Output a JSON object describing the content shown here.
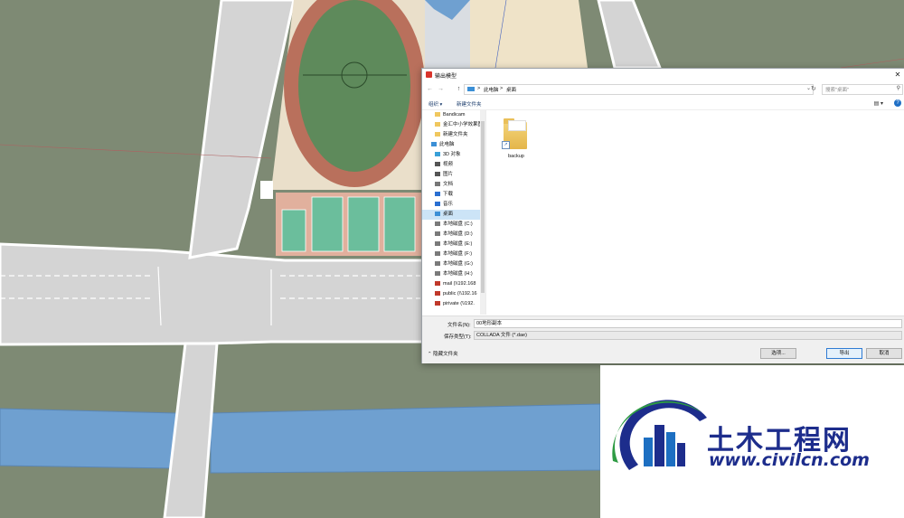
{
  "colors": {
    "field": "#7e8a74",
    "road": "#d4d4d4",
    "river": "#6fa0d0",
    "track": "#b9705c",
    "pitch": "#5e8a5b",
    "court": "#e1b09d",
    "court_green": "#6bbe9c",
    "accent": "#1d2d8c",
    "selection": "#cce4f7",
    "help": "#1f6fc5"
  },
  "dialog": {
    "title": "输出模型",
    "close_icon": "close-icon",
    "nav": {
      "back": "←",
      "forward": "→",
      "up": "↑"
    },
    "address": {
      "crumbs": [
        "此电脑",
        "桌面"
      ],
      "sep": ">"
    },
    "search_placeholder": "搜索\"桌面\"",
    "toolbar": {
      "organize": "组织 ▾",
      "new_folder": "新建文件夹",
      "help": "?"
    },
    "nav_items": [
      {
        "label": "Bandicam",
        "icon": "folder-icon",
        "color": "#f0c75e"
      },
      {
        "label": "金汇中小学效果图",
        "icon": "folder-icon",
        "color": "#f0c75e"
      },
      {
        "label": "新建文件夹",
        "icon": "folder-icon",
        "color": "#f0c75e"
      },
      {
        "label": "此电脑",
        "icon": "pc-icon",
        "color": "#3b8fd6"
      },
      {
        "label": "3D 对象",
        "icon": "cube-icon",
        "color": "#39a0d8"
      },
      {
        "label": "视频",
        "icon": "video-icon",
        "color": "#555555"
      },
      {
        "label": "图片",
        "icon": "picture-icon",
        "color": "#555555"
      },
      {
        "label": "文档",
        "icon": "document-icon",
        "color": "#777777"
      },
      {
        "label": "下载",
        "icon": "download-icon",
        "color": "#2a6fd1"
      },
      {
        "label": "音乐",
        "icon": "music-icon",
        "color": "#2a6fd1"
      },
      {
        "label": "桌面",
        "icon": "desktop-icon",
        "color": "#3b8fd6",
        "selected": true
      },
      {
        "label": "本地磁盘 (C:)",
        "icon": "drive-c-icon",
        "color": "#7a7a7a"
      },
      {
        "label": "本地磁盘 (D:)",
        "icon": "drive-icon",
        "color": "#7a7a7a"
      },
      {
        "label": "本地磁盘 (E:)",
        "icon": "drive-icon",
        "color": "#7a7a7a"
      },
      {
        "label": "本地磁盘 (F:)",
        "icon": "drive-icon",
        "color": "#7a7a7a"
      },
      {
        "label": "本地磁盘 (G:)",
        "icon": "drive-icon",
        "color": "#7a7a7a"
      },
      {
        "label": "本地磁盘 (H:)",
        "icon": "drive-icon",
        "color": "#7a7a7a"
      },
      {
        "label": "mail (\\\\192.168",
        "icon": "network-drive-icon",
        "color": "#c0392b"
      },
      {
        "label": "public (\\\\192.16",
        "icon": "network-drive-icon",
        "color": "#c0392b"
      },
      {
        "label": "pirivate (\\\\192.",
        "icon": "network-drive-icon",
        "color": "#c0392b"
      }
    ],
    "files": [
      {
        "name": "backup",
        "icon": "folder-shortcut-icon"
      }
    ],
    "filename_label": "文件名(N):",
    "filename_value": "00地形副本",
    "filetype_label": "保存类型(T):",
    "filetype_value": "COLLADA 文件 (*.dae)",
    "hide_folders": "⌃ 隐藏文件夹",
    "buttons": {
      "options": "选项...",
      "export": "导出",
      "cancel": "取消"
    }
  },
  "watermark": {
    "name": "土木工程网",
    "url": "www.civilcn.com"
  }
}
